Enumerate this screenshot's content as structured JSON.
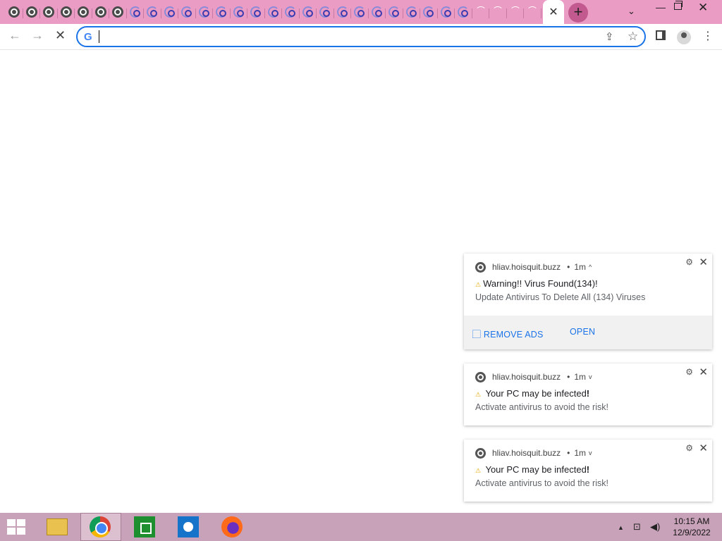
{
  "tabs": {
    "favicons": [
      "chrome",
      "chrome",
      "chrome",
      "chrome",
      "chrome",
      "chrome",
      "chrome",
      "spin",
      "spin",
      "spin",
      "spin",
      "spin",
      "spin",
      "spin",
      "spin",
      "spin",
      "spin",
      "spin",
      "spin",
      "spin",
      "spin",
      "spin",
      "spin",
      "spin",
      "spin",
      "spin",
      "spin",
      "empty",
      "empty",
      "empty",
      "empty",
      "empty"
    ],
    "active_close": "✕",
    "new_tab": "+",
    "tab_search": "⌄"
  },
  "window": {
    "minimize": "—",
    "close": "✕"
  },
  "toolbar": {
    "back": "←",
    "forward": "→",
    "stop": "✕",
    "omnibox_logo": "G",
    "omnibox_value": "",
    "share": "⇪",
    "bookmark": "☆",
    "menu": "⋮"
  },
  "notifications": [
    {
      "site": "hliav.hoisquit.buzz",
      "time": "1m",
      "chevron": "^",
      "title": "Warning!! Virus Found(134)!",
      "body": "Update Antivirus To Delete All (134) Viruses",
      "actions": [
        "⃞ REMOVE ADS",
        "OPEN"
      ]
    },
    {
      "site": "hliav.hoisquit.buzz",
      "time": "1m",
      "chevron": "v",
      "title": "Your PC may be infected",
      "title_bang": "!",
      "body": "Activate antivirus to avoid the risk!"
    },
    {
      "site": "hliav.hoisquit.buzz",
      "time": "1m",
      "chevron": "v",
      "title": "Your PC may be infected",
      "title_bang": "!",
      "body": "Activate antivirus to avoid the risk!"
    }
  ],
  "taskbar": {
    "clock_time": "10:15 AM",
    "clock_date": "12/9/2022",
    "tray_up": "▲",
    "tray_network": "⊡",
    "tray_volume": "◀)"
  },
  "colors": {
    "tabstrip": "#eb9cc4",
    "accent": "#1a73e8",
    "taskbar": "#c8a2b8"
  }
}
